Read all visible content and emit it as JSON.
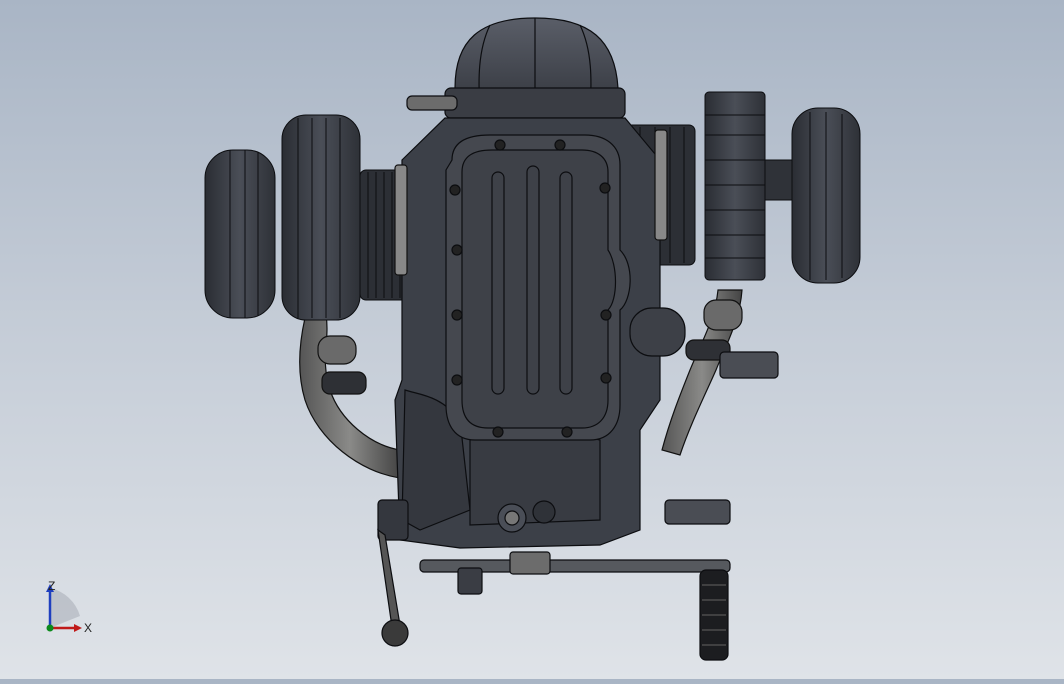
{
  "viewport": {
    "background_top": "#a9b5c5",
    "background_bottom": "#dfe3e8",
    "model_color": "#3c4048",
    "edge_color": "#0c0d10"
  },
  "triad": {
    "z_label": "Z",
    "x_label": "X",
    "z_color": "#1f3fbf",
    "x_color": "#c01a1a",
    "origin_color": "#0b8a1c"
  }
}
